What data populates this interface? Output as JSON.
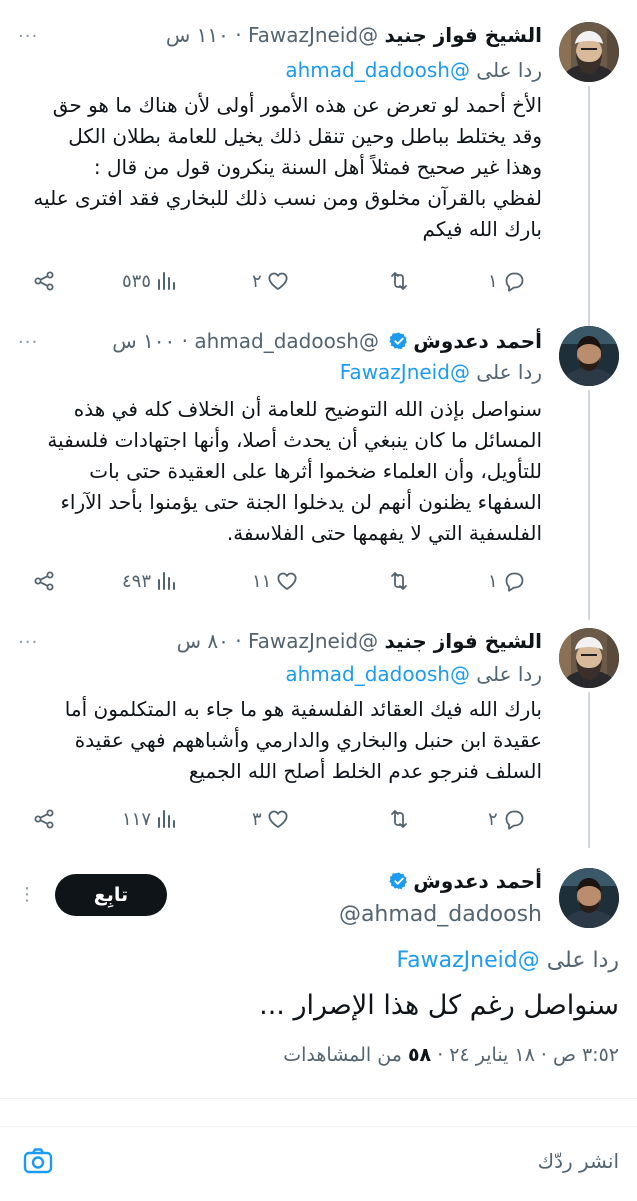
{
  "reply_label": "ردا على",
  "tweets": [
    {
      "name": "الشيخ فواز جنيد",
      "handle": "@FawazJneid",
      "time": "١١٠ س",
      "reply_to": "@ahmad_dadoosh",
      "verified": false,
      "lines": [
        "الأخ أحمد لو تعرض عن هذه الأمور أولى لأن هناك ما هو حق",
        "وقد يختلط بباطل وحين تنقل ذلك يخيل للعامة بطلان الكل",
        "وهذا غير صحيح فمثلاً أهل السنة ينكرون قول من قال :",
        "لفظي بالقرآن مخلوق ومن نسب ذلك للبخاري فقد افترى عليه",
        "بارك الله فيكم"
      ],
      "replies": "١",
      "likes": "٢",
      "views": "٥٣٥"
    },
    {
      "name": "أحمد دعدوش",
      "handle": "@ahmad_dadoosh",
      "time": "١٠٠ س",
      "reply_to": "@FawazJneid",
      "verified": true,
      "lines": [
        "سنواصل بإذن الله التوضيح للعامة أن الخلاف كله في هذه",
        "المسائل ما كان ينبغي أن يحدث أصلا، وأنها اجتهادات فلسفية",
        "للتأويل، وأن العلماء ضخموا أثرها على العقيدة حتى بات",
        "السفهاء يظنون أنهم لن يدخلوا الجنة حتى يؤمنوا بأحد الآراء",
        "الفلسفية التي لا يفهمها حتى الفلاسفة."
      ],
      "replies": "١",
      "likes": "١١",
      "views": "٤٩٣"
    },
    {
      "name": "الشيخ فواز جنيد",
      "handle": "@FawazJneid",
      "time": "٨٠ س",
      "reply_to": "@ahmad_dadoosh",
      "verified": false,
      "lines": [
        "بارك الله فيك العقائد الفلسفية هو ما جاء به المتكلمون أما",
        "عقيدة ابن حنبل والبخاري والدارمي وأشباههم فهي عقيدة",
        "السلف فنرجو عدم الخلط أصلح الله الجميع"
      ],
      "replies": "٢",
      "likes": "٣",
      "views": "١١٧"
    }
  ],
  "main": {
    "name": "أحمد دعدوش",
    "handle": "@ahmad_dadoosh",
    "follow_label": "تابِع",
    "reply_to": "@FawazJneid",
    "text": "سنواصل رغم كل هذا الإصرار ...",
    "time": "٣:٥٢ ص",
    "date": "١٨ يناير ٢٤",
    "views_count": "٥٨",
    "views_label": "من المشاهدات"
  },
  "composer": {
    "placeholder": "انشر ردّك"
  },
  "colors": {
    "accent": "#1d9bf0",
    "text": "#0f1419",
    "muted": "#536471",
    "divider": "#eff3f4"
  },
  "icons": [
    "reply-icon",
    "retweet-icon",
    "like-icon",
    "views-icon",
    "share-icon",
    "verified-icon",
    "more-icon",
    "camera-icon"
  ]
}
